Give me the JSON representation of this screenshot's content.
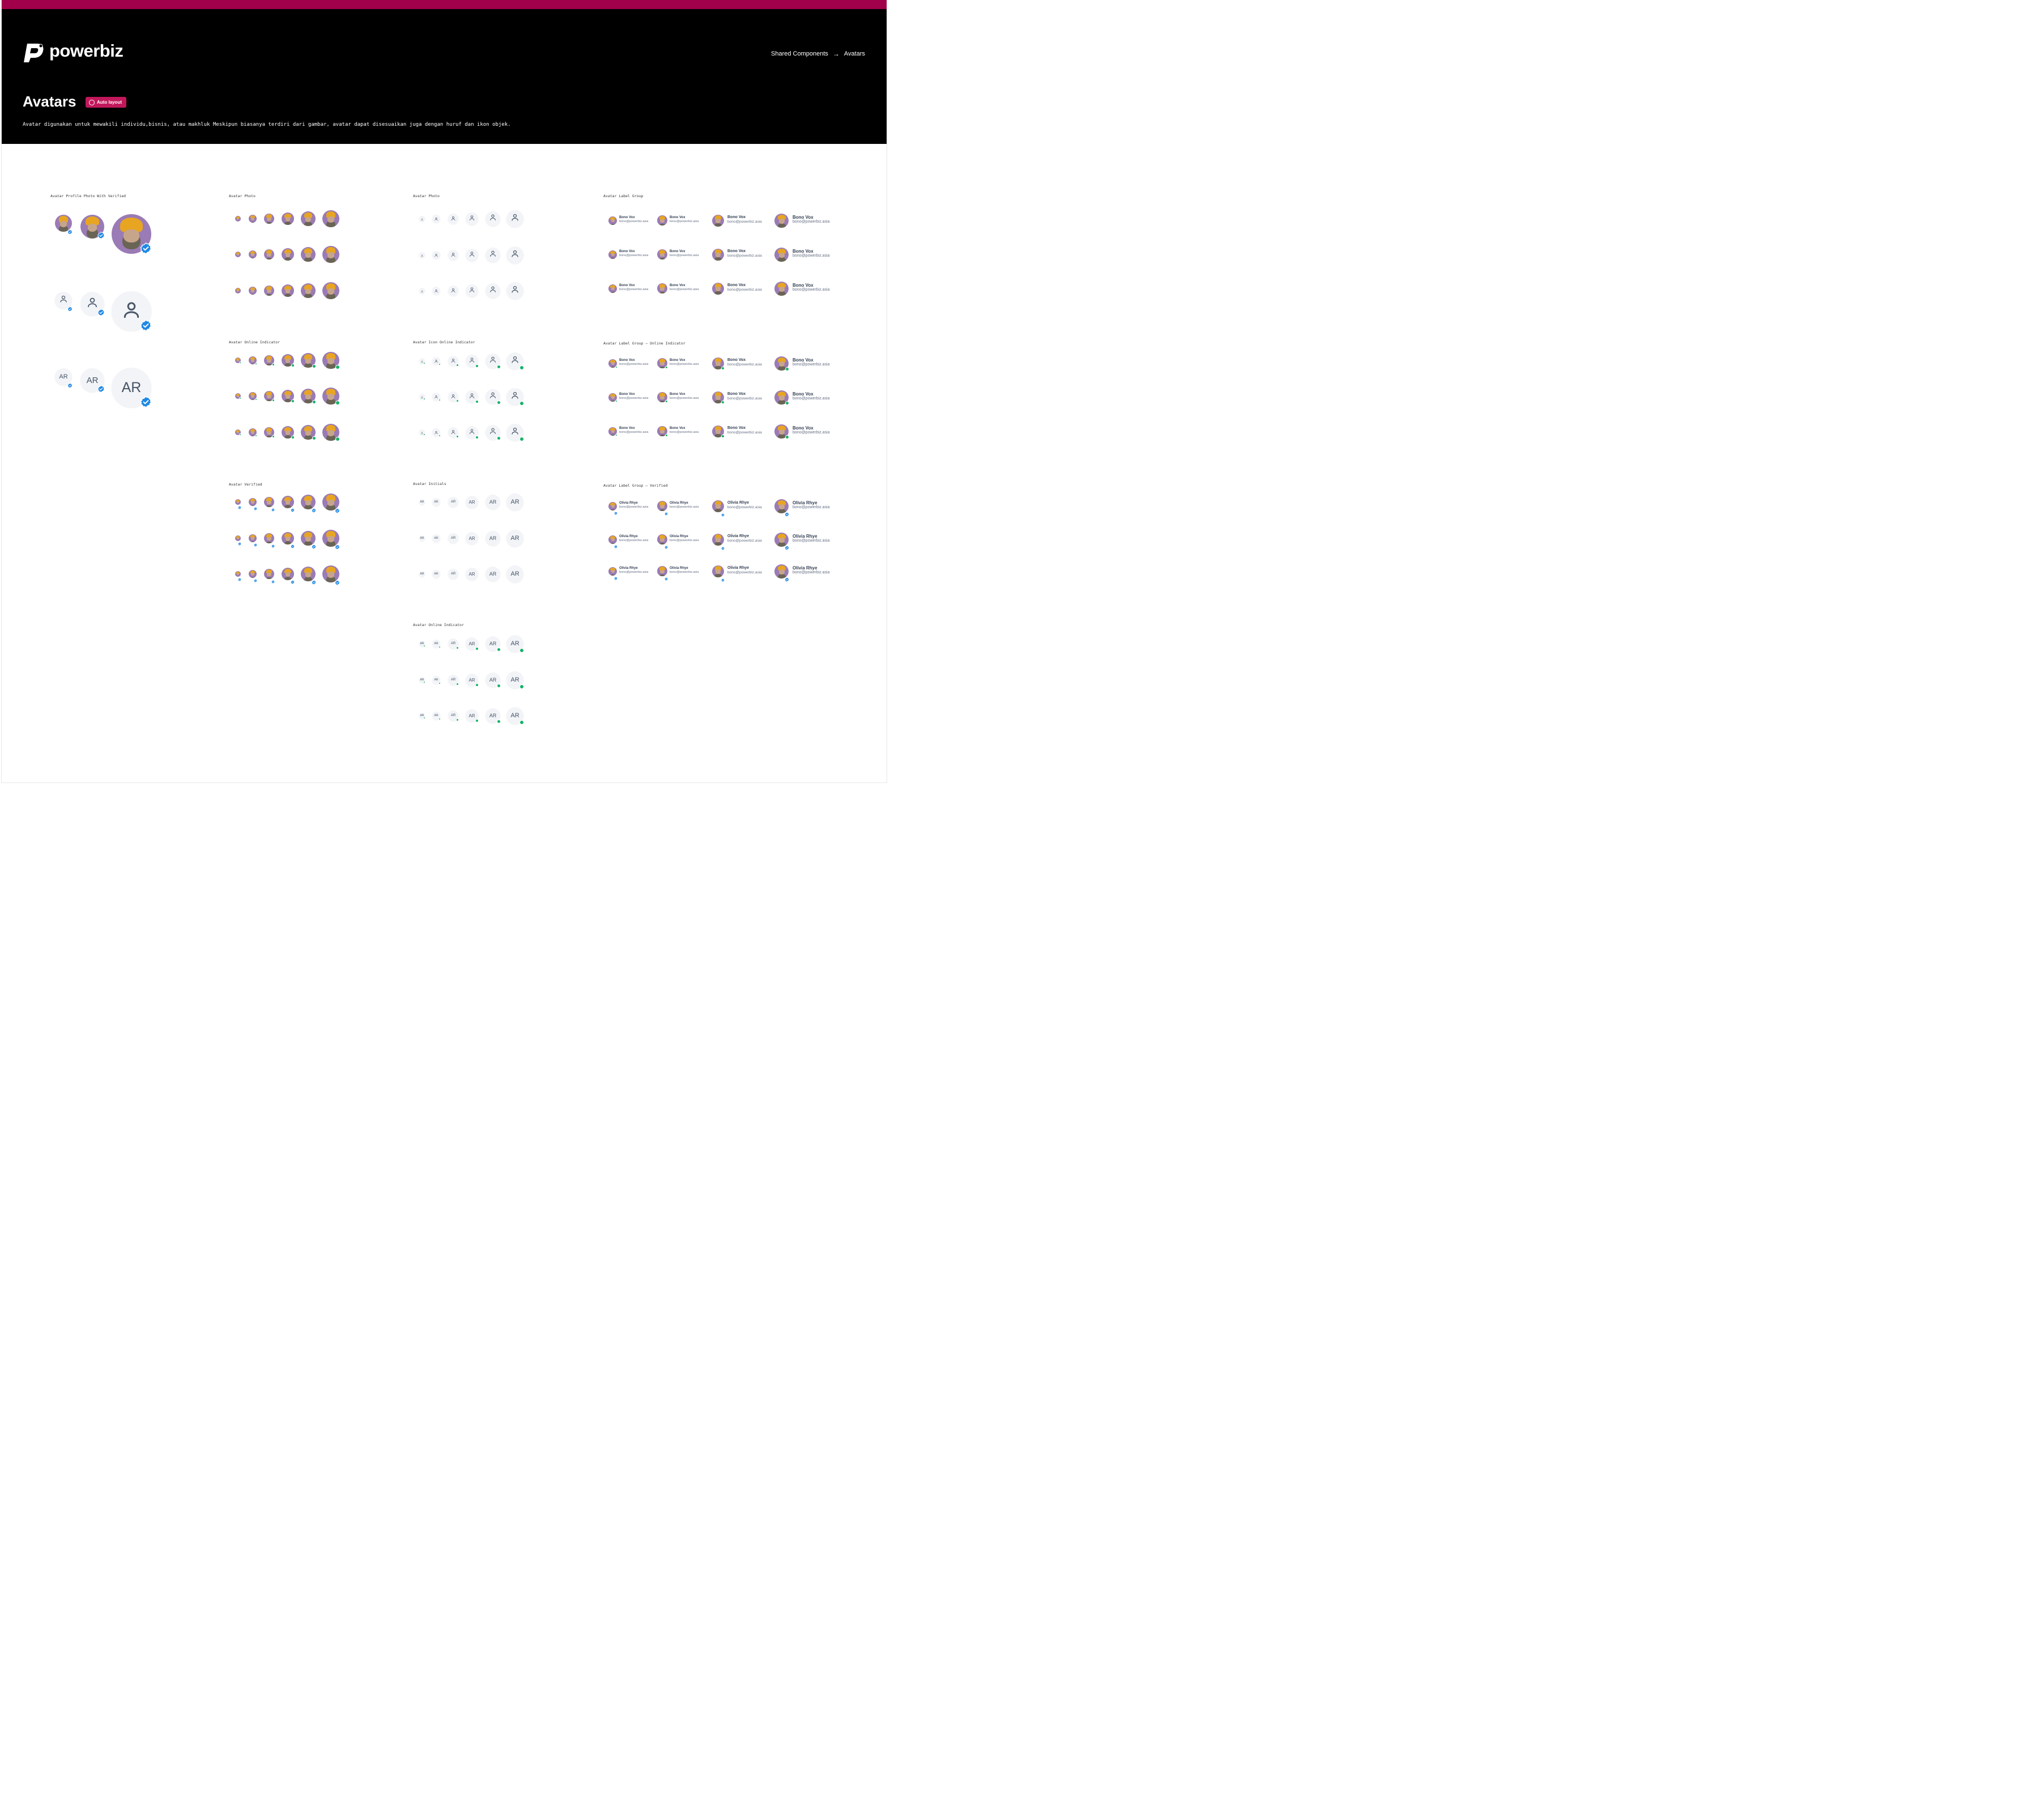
{
  "header": {
    "brand": "powerbiz",
    "breadcrumb": {
      "parent": "Shared Components",
      "arrow": "→",
      "current": "Avatars"
    },
    "title": "Avatars",
    "badge": "Auto layout",
    "description": "Avatar digunakan untuk mewakili individu,bisnis, atau makhluk Meskipun biasanya terdiri dari gambar, avatar dapat disesuaikan juga dengan huruf dan ikon objek."
  },
  "sections": {
    "profile_verified": "Avatar Profile Photo With Verified",
    "photo": "Avatar Photo",
    "icon_photo": "Avatar Photo",
    "label_group": "Avatar Label Group",
    "online": "Avatar Online Indicator",
    "icon_online": "Avatar Icon Online Indicator",
    "label_online": "Avatar Label Group — Online Indicator",
    "verified": "Avatar Verified",
    "initials": "Avatar Initials",
    "label_verified": "Avatar Label Group — Verified",
    "initials_online": "Avatar Online Indicator"
  },
  "initials": "AR",
  "label_default": {
    "name": "Bono Vox",
    "email": "bono@powerbiz.asia"
  },
  "label_verified": {
    "name": "Olivia Rhye",
    "email": "bono@powerbiz.asia"
  },
  "colors": {
    "brand": "#a1004a",
    "badge": "#c2185b",
    "online": "#17b26a",
    "verified": "#1e88e5"
  }
}
